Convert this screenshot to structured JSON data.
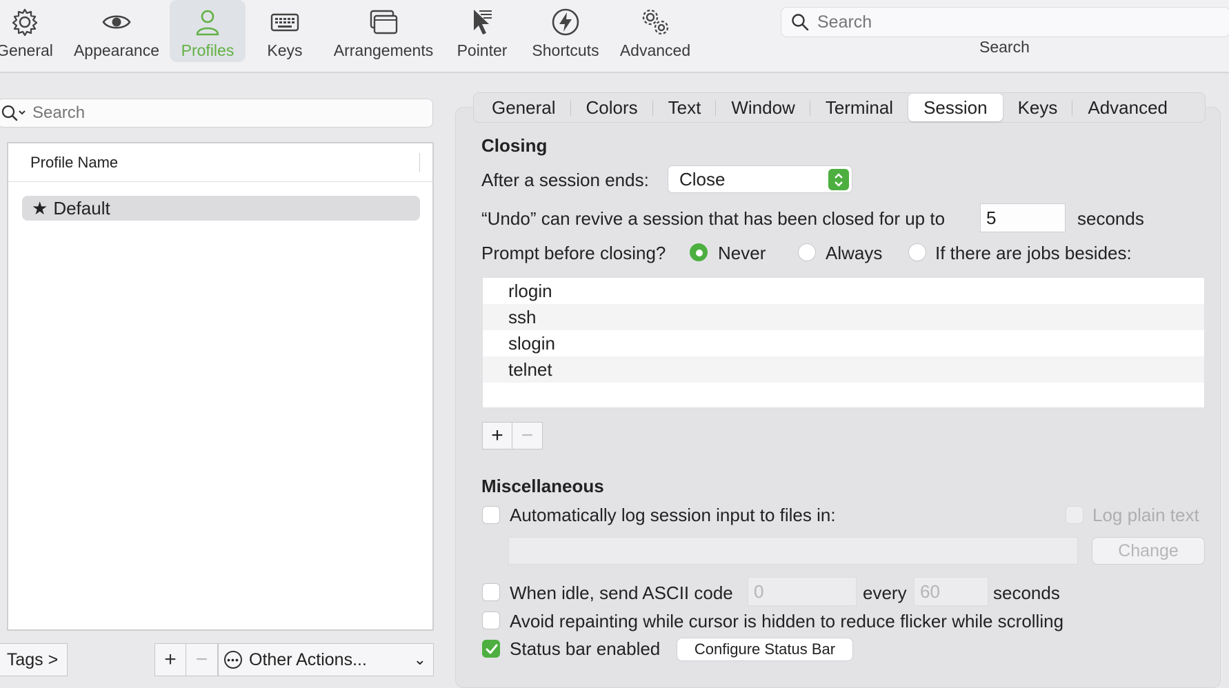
{
  "toolbar": {
    "items": [
      {
        "label": "General",
        "icon": "gear-icon"
      },
      {
        "label": "Appearance",
        "icon": "eye-icon"
      },
      {
        "label": "Profiles",
        "icon": "person-icon"
      },
      {
        "label": "Keys",
        "icon": "keyboard-icon"
      },
      {
        "label": "Arrangements",
        "icon": "windows-icon"
      },
      {
        "label": "Pointer",
        "icon": "pointer-icon"
      },
      {
        "label": "Shortcuts",
        "icon": "bolt-icon"
      },
      {
        "label": "Advanced",
        "icon": "gears-icon"
      }
    ],
    "active": "Profiles",
    "search_placeholder": "Search",
    "search_label": "Search",
    "accent_color": "#62b043"
  },
  "profiles": {
    "search_placeholder": "Search",
    "column_header": "Profile Name",
    "rows": [
      {
        "name": "Default",
        "star": "★"
      }
    ],
    "tags_label": "Tags >",
    "add_label": "+",
    "remove_label": "−",
    "other_actions_label": "Other Actions...",
    "other_actions_icon": "ellipsis-circle-icon"
  },
  "tabs": [
    "General",
    "Colors",
    "Text",
    "Window",
    "Terminal",
    "Session",
    "Keys",
    "Advanced"
  ],
  "active_tab": "Session",
  "closing": {
    "title": "Closing",
    "after_session_ends_label": "After a session ends:",
    "after_session_ends_value": "Close",
    "undo_label": "“Undo” can revive a session that has been closed for up to",
    "undo_value": "5",
    "undo_units": "seconds",
    "prompt_label": "Prompt before closing?",
    "prompt_options": [
      "Never",
      "Always",
      "If there are jobs besides:"
    ],
    "prompt_selected": "Never",
    "jobs": [
      "rlogin",
      "ssh",
      "slogin",
      "telnet"
    ],
    "add_label": "+",
    "remove_label": "−"
  },
  "misc": {
    "title": "Miscellaneous",
    "auto_log_label": "Automatically log session input to files in:",
    "auto_log_checked": false,
    "log_plain_text_label": "Log plain text",
    "log_path_value": "",
    "change_label": "Change",
    "idle_label": "When idle, send ASCII code",
    "idle_checked": false,
    "idle_code": "0",
    "every_label": "every",
    "idle_seconds": "60",
    "seconds_label": "seconds",
    "avoid_repaint_label": "Avoid repainting while cursor is hidden to reduce flicker while scrolling",
    "avoid_repaint_checked": false,
    "status_bar_label": "Status bar enabled",
    "status_bar_checked": true,
    "configure_status_bar_label": "Configure Status Bar"
  }
}
